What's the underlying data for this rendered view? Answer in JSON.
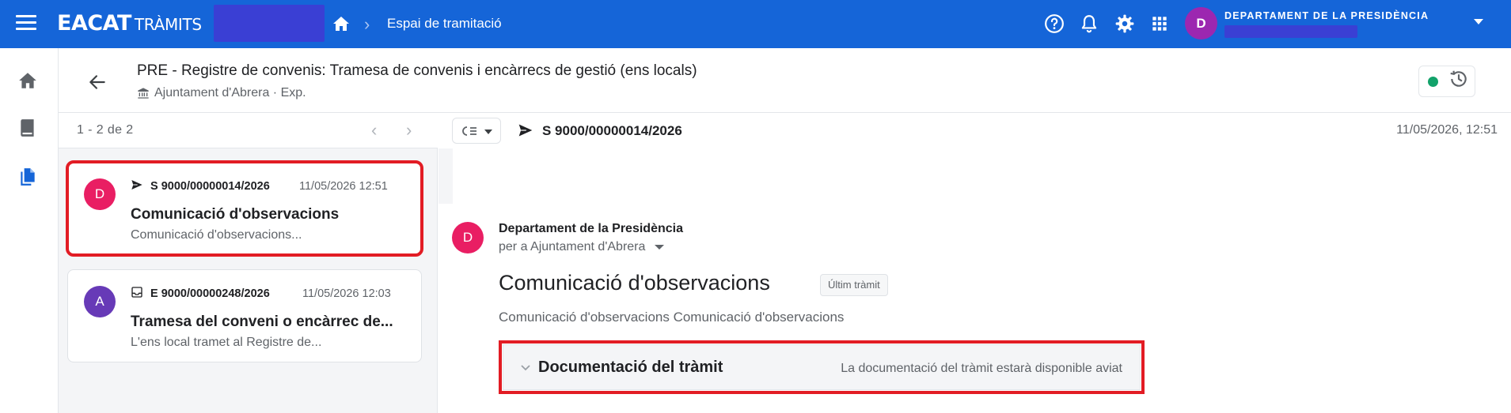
{
  "topbar": {
    "logo_main": "EACAT",
    "logo_sub": "TRÀMITS",
    "breadcrumb": "Espai de tramitació",
    "user_avatar_letter": "D",
    "user_dept": "DEPARTAMENT DE LA PRESIDÈNCIA",
    "bg_color": "#1565d8",
    "icons": [
      "menu-icon",
      "home-icon",
      "chevron-right-icon",
      "help-icon",
      "bell-icon",
      "gear-icon",
      "apps-grid-icon",
      "chevron-down-icon"
    ]
  },
  "rail": {
    "icons": [
      "home-icon",
      "book-icon",
      "copy-documents-icon"
    ]
  },
  "header": {
    "title": "PRE - Registre de convenis: Tramesa de convenis i encàrrecs de gestió (ens locals)",
    "subtitle": "Ajuntament d'Abrera · Exp.",
    "status_color": "#12a26a"
  },
  "list": {
    "count": "1 - 2 de 2",
    "cards": [
      {
        "avatar": "D",
        "avatar_color": "#e91e63",
        "kind": "sortida",
        "ref": "S 9000/00000014/2026",
        "date": "11/05/2026 12:51",
        "title": "Comunicació d'observacions",
        "preview": "Comunicació d'observacions..."
      },
      {
        "avatar": "A",
        "avatar_color": "#673ab7",
        "kind": "entrada",
        "ref": "E 9000/00000248/2026",
        "date": "11/05/2026 12:03",
        "title": "Tramesa del conveni o encàrrec de...",
        "preview": "L'ens local tramet al Registre de..."
      }
    ]
  },
  "detail": {
    "ref": "S 9000/00000014/2026",
    "date": "11/05/2026, 12:51",
    "from": "Departament de la Presidència",
    "to": "per a Ajuntament d'Abrera",
    "avatar": "D",
    "title": "Comunicació d'observacions",
    "badge": "Últim tràmit",
    "body": "Comunicació d'observacions Comunicació d'observacions",
    "doc_section_title": "Documentació del tràmit",
    "doc_section_note": "La documentació del tràmit estarà disponible aviat"
  }
}
